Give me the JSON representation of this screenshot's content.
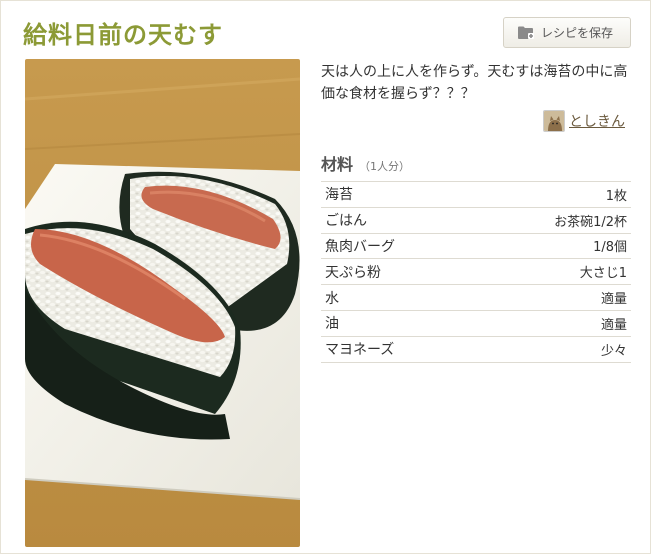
{
  "recipe": {
    "title": "給料日前の天むす",
    "save_button_label": "レシピを保存",
    "description": "天は人の上に人を作らず。天むすは海苔の中に高価な食材を握らず？？？",
    "author": "としきん"
  },
  "ingredients": {
    "heading": "材料",
    "servings": "（1人分）",
    "items": [
      {
        "name": "海苔",
        "qty": "1枚"
      },
      {
        "name": "ごはん",
        "qty": "お茶碗1/2杯"
      },
      {
        "name": "魚肉バーグ",
        "qty": "1/8個"
      },
      {
        "name": "天ぷら粉",
        "qty": "大さじ1"
      },
      {
        "name": "水",
        "qty": "適量"
      },
      {
        "name": "油",
        "qty": "適量"
      },
      {
        "name": "マヨネーズ",
        "qty": "少々"
      }
    ]
  },
  "icons": {
    "save": "folder-plus-icon",
    "avatar": "cat-avatar"
  },
  "colors": {
    "title": "#8c9a36",
    "author_link": "#6b5a3e",
    "row_border": "#dedbd2"
  }
}
